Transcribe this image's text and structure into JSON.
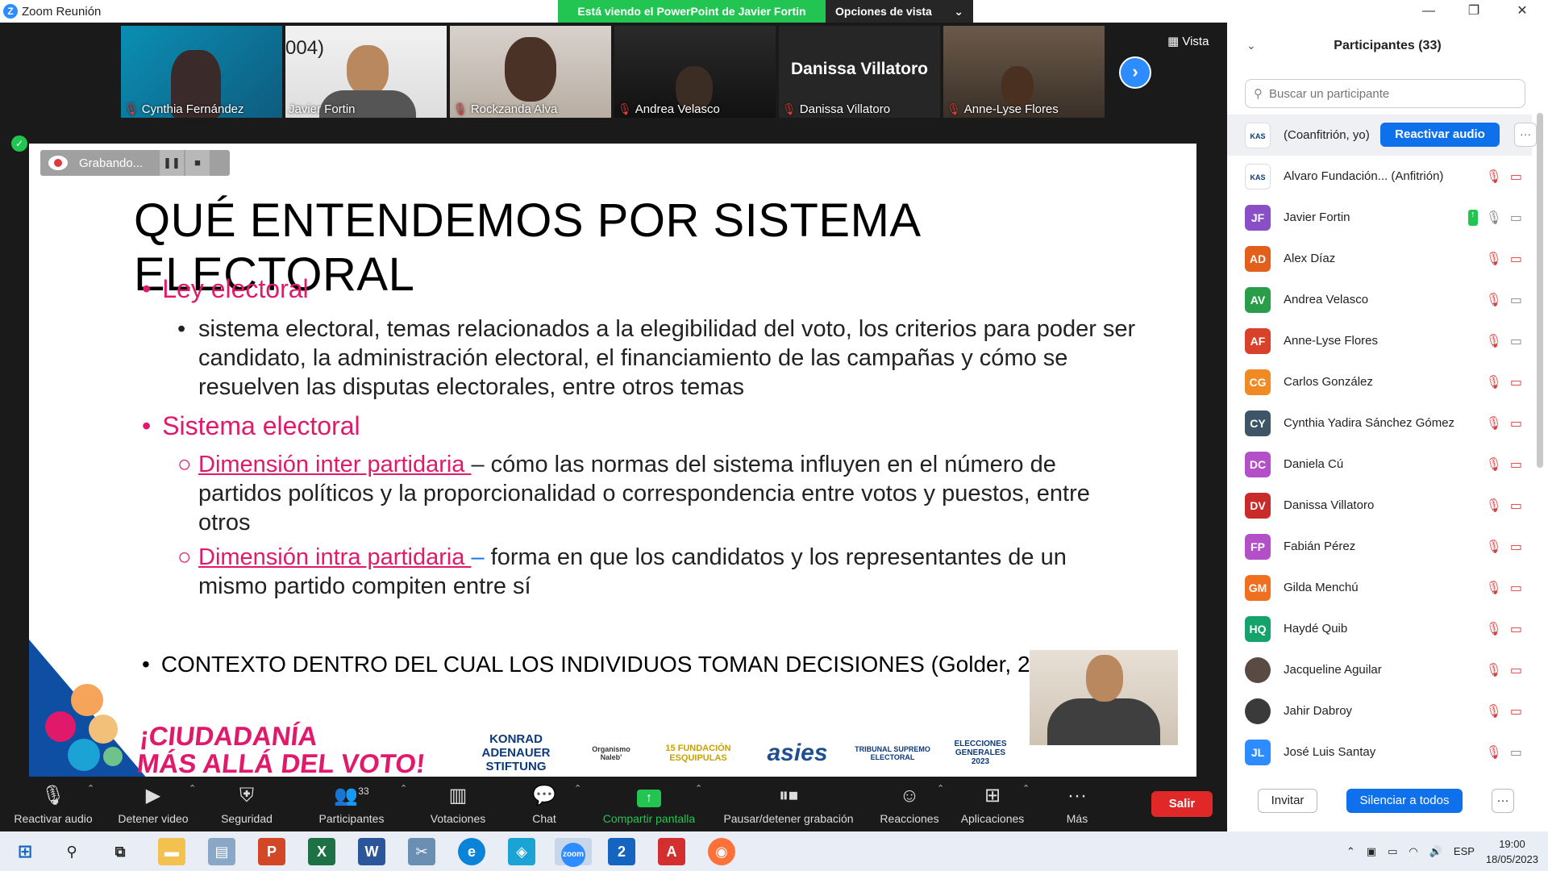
{
  "window": {
    "title": "Zoom Reunión",
    "minimize": "—",
    "maximize": "❐",
    "close": "✕"
  },
  "banner": {
    "sharing_text": "Está viendo el PowerPoint de Javier Fortin",
    "view_options": "Opciones de vista"
  },
  "thumbnails": [
    {
      "name": "Cynthia Fernández",
      "muted": true
    },
    {
      "name": "Javier Fortin",
      "muted": false,
      "overlay_text": "004)"
    },
    {
      "name": "Rockzanda Alva",
      "muted": true
    },
    {
      "name": "Andrea Velasco",
      "muted": true
    },
    {
      "name": "Danissa Villatoro",
      "muted": true,
      "display_name": "Danissa Villatoro"
    },
    {
      "name": "Anne-Lyse Flores",
      "muted": true
    }
  ],
  "vista_label": "Vista",
  "recording": {
    "label": "Grabando...",
    "pause": "❚❚",
    "stop": "■"
  },
  "slide": {
    "title": "QUÉ ENTENDEMOS POR SISTEMA ELECTORAL",
    "bullet1": "Ley electoral",
    "bullet1_sub": "sistema electoral, temas relacionados a la elegibilidad del voto, los criterios para poder ser candidato, la administración electoral, el financiamiento de las campañas y cómo se resuelven las disputas electorales, entre otros temas",
    "bullet2": "Sistema electoral",
    "sub1_link": "Dimensión inter partidaria ",
    "sub1_text": "– cómo las normas del sistema influyen en el número de partidos políticos y la proporcionalidad o correspondencia entre votos y puestos, entre otros",
    "sub2_link": "Dimensión intra partidaria ",
    "sub2_dash": "– ",
    "sub2_text": "forma en que los candidatos y los representantes de un mismo partido compiten entre sí",
    "context": "CONTEXTO DENTRO DEL CUAL LOS INDIVIDUOS TOMAN DECISIONES (Golder, 2004)",
    "campaign_line1": "¡CIUDADANÍA",
    "campaign_line2": "MÁS ALLÁ DEL VOTO!",
    "logos": [
      "KONRAD ADENAUER STIFTUNG",
      "Organismo Naleb'",
      "15 FUNDACIÓN ESQUIPULAS",
      "asies",
      "TRIBUNAL SUPREMO ELECTORAL",
      "ELECCIONES GENERALES 2023"
    ]
  },
  "participants_panel": {
    "title": "Participantes (33)",
    "search_placeholder": "Buscar un participante",
    "reactivar_audio": "Reactivar audio",
    "participants": [
      {
        "initials": "",
        "name": "(Coanfitrión, yo)",
        "color": "#ffffff",
        "logo": true
      },
      {
        "initials": "",
        "name": "Alvaro Fundación...  (Anfitrión)",
        "color": "#ffffff",
        "logo": true
      },
      {
        "initials": "JF",
        "name": "Javier Fortin",
        "color": "#8a4fc7"
      },
      {
        "initials": "AD",
        "name": "Alex Díaz",
        "color": "#e35f1c"
      },
      {
        "initials": "AV",
        "name": "Andrea Velasco",
        "color": "#2a9d4a"
      },
      {
        "initials": "AF",
        "name": "Anne-Lyse Flores",
        "color": "#d9412b"
      },
      {
        "initials": "CG",
        "name": "Carlos González",
        "color": "#f08a24"
      },
      {
        "initials": "CY",
        "name": "Cynthia Yadira Sánchez Gómez",
        "color": "#3d5566"
      },
      {
        "initials": "DC",
        "name": "Daniela Cú",
        "color": "#b34fc7"
      },
      {
        "initials": "DV",
        "name": "Danissa Villatoro",
        "color": "#c92a2a"
      },
      {
        "initials": "FP",
        "name": "Fabián Pérez",
        "color": "#b34fc7"
      },
      {
        "initials": "GM",
        "name": "Gilda Menchú",
        "color": "#f07020"
      },
      {
        "initials": "HQ",
        "name": "Haydé Quib",
        "color": "#14a36a"
      },
      {
        "initials": "",
        "name": "Jacqueline Aguilar",
        "color": "#5a4a44",
        "photo": true
      },
      {
        "initials": "",
        "name": "Jahir Dabroy",
        "color": "#3a3a3a",
        "photo": true
      },
      {
        "initials": "JL",
        "name": "José Luis Santay",
        "color": "#2d8cff"
      }
    ],
    "invite": "Invitar",
    "mute_all": "Silenciar a todos",
    "more": "···"
  },
  "toolbar": {
    "unmute": "Reactivar audio",
    "stop_video": "Detener video",
    "security": "Seguridad",
    "participants": "Participantes",
    "participants_count": "33",
    "polls": "Votaciones",
    "chat": "Chat",
    "share": "Compartir pantalla",
    "recording": "Pausar/detener grabación",
    "reactions": "Reacciones",
    "apps": "Aplicaciones",
    "more": "Más",
    "leave": "Salir"
  },
  "taskbar": {
    "lang": "ESP",
    "time": "19:00",
    "date": "18/05/2023"
  },
  "colors": {
    "accent": "#2d8cff",
    "slide_pink": "#e0196b",
    "share_green": "#23c552",
    "leave_red": "#e02828"
  }
}
